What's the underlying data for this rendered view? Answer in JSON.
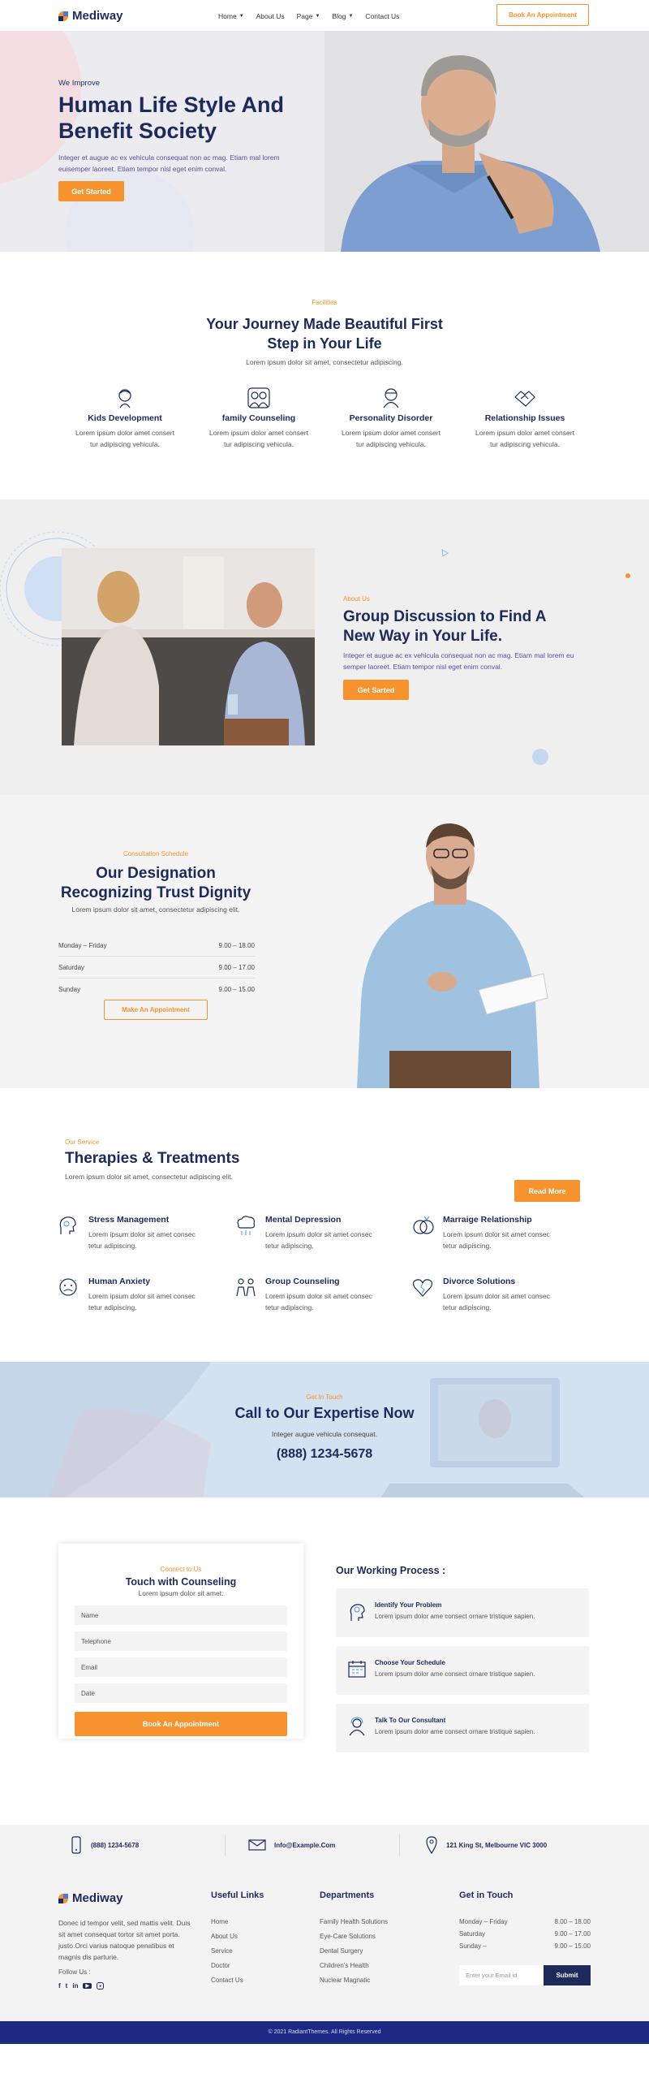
{
  "header": {
    "logo_text": "Mediway",
    "nav": [
      {
        "label": "Home",
        "dropdown": true
      },
      {
        "label": "About Us",
        "dropdown": false
      },
      {
        "label": "Page",
        "dropdown": true
      },
      {
        "label": "Blog",
        "dropdown": true
      },
      {
        "label": "Contact Us",
        "dropdown": false
      }
    ],
    "cta": "Book An Appointment"
  },
  "hero": {
    "kicker": "We Improve",
    "title_line1": "Human Life Style And",
    "title_line2": "Benefit Society",
    "text": "Integer et augue ac ex vehicula consequat non ac mag. Etiam mal lorem euisemper laoreet. Etiam tempor nisl eget enim conval.",
    "button": "Get Started"
  },
  "facilities": {
    "kicker": "Facilities",
    "title_line1": "Your Journey Made Beautiful First",
    "title_line2": "Step in Your Life",
    "subtitle": "Lorem ipsum dolor sit amet, consectetur adipiscing.",
    "items": [
      {
        "icon": "child-icon",
        "title": "Kids Development",
        "text1": "Lorem ipsum dolor amet consert",
        "text2": "tur adipiscing vehicula."
      },
      {
        "icon": "family-icon",
        "title": "family Counseling",
        "text1": "Lorem ipsum dolor amet consert",
        "text2": "tur adipiscing vehicula."
      },
      {
        "icon": "person-icon",
        "title": "Personality Disorder",
        "text1": "Lorem ipsum dolor amet consert",
        "text2": "tur adipiscing vehicula."
      },
      {
        "icon": "handshake-icon",
        "title": "Relationship Issues",
        "text1": "Lorem ipsum dolor amet consert",
        "text2": "tur adipiscing vehicula."
      }
    ]
  },
  "about": {
    "kicker": "About Us",
    "title_line1": "Group Discussion to Find A",
    "title_line2": "New Way in Your Life.",
    "text": "Integer et augue ac ex vehicula consequat non ac mag. Etiam mal lorem eu semper laoreet. Etiam tempor nisl eget enim conval.",
    "button": "Get Sarted"
  },
  "schedule": {
    "kicker": "Consultation Schedule",
    "title_line1": "Our Designation",
    "title_line2": "Recognizing Trust Dignity",
    "subtitle": "Lorem ipsum dolor sit amet, consectetur adipiscing elit.",
    "rows": [
      {
        "day": "Monday – Friday",
        "time": "9.00 – 18.00"
      },
      {
        "day": "Saturday",
        "time": "9.00 – 17.00"
      },
      {
        "day": "Sunday",
        "time": "9.00 – 15.00"
      }
    ],
    "button": "Make An Appointment"
  },
  "services": {
    "kicker": "Our Service",
    "title": "Therapies & Treatments",
    "subtitle": "Lorem ipsum dolor sit amet, consectetur adipiscing elit.",
    "button": "Read More",
    "items": [
      {
        "icon": "head-icon",
        "title": "Stress Management",
        "text1": "Lorem ipsum dolor sit amet consec",
        "text2": "tetur adipiscing."
      },
      {
        "icon": "brain-cloud-icon",
        "title": "Mental Depression",
        "text1": "Lorem ipsum dolor sit amet consec",
        "text2": "tetur adipiscing."
      },
      {
        "icon": "rings-icon",
        "title": "Marraige Relationship",
        "text1": "Lorem ipsum dolor sit amet consec",
        "text2": "tetur adipiscing."
      },
      {
        "icon": "anxiety-face-icon",
        "title": "Human Anxiety",
        "text1": "Lorem ipsum dolor sit amet consec",
        "text2": "tetur adipiscing."
      },
      {
        "icon": "group-icon",
        "title": "Group Counseling",
        "text1": "Lorem ipsum dolor sit amet consec",
        "text2": "tetur adipiscing."
      },
      {
        "icon": "broken-heart-icon",
        "title": "Divorce Solutions",
        "text1": "Lorem ipsum dolor sit amet consec",
        "text2": "tetur adipiscing."
      }
    ]
  },
  "call": {
    "kicker": "Get In Touch",
    "title": "Call to Our Expertise Now",
    "subtitle": "Integer augue vehicula consequat.",
    "phone": "(888) 1234-5678"
  },
  "contact_form": {
    "kicker": "Connect to Us",
    "title": "Touch with Counseling",
    "subtitle": "Lorem ipsum dolor sit amet.",
    "placeholders": [
      "Name",
      "Telephone",
      "Email",
      "Date"
    ],
    "button": "Book An Appointment"
  },
  "process": {
    "title": "Our Working Process :",
    "steps": [
      {
        "icon": "lightbulb-head-icon",
        "title": "Identify Your Problem",
        "text": "Lorem ipsum dolor ame consect ornare tristique sapien."
      },
      {
        "icon": "calendar-icon",
        "title": "Choose Your Schedule",
        "text": "Lorem ipsum dolor ame consect ornare tristique sapien."
      },
      {
        "icon": "consultant-icon",
        "title": "Talk To Our Consultant",
        "text": "Lorem ipsum dolor ame consect ornare tristique sapien."
      }
    ]
  },
  "contact_bar": {
    "phone": "(888) 1234-5678",
    "email": "Info@Example.Com",
    "address": "121 King St, Melbourne VIC 3000"
  },
  "footer": {
    "logo_text": "Mediway",
    "about": "Donec id tempor velit, sed mattis velit. Duis sit amet consequat tortor sit amet porta. justo.Orci varius natoque penatibus et magnis dis parturie.",
    "follow": "Follow Us :",
    "social": [
      "facebook-icon",
      "twitter-icon",
      "linkedin-icon",
      "youtube-icon",
      "instagram-icon"
    ],
    "useful_title": "Useful Links",
    "useful": [
      "Home",
      "About Us",
      "Service",
      "Doctor",
      "Contact Us"
    ],
    "dept_title": "Departments",
    "departments": [
      "Family Health Solutions",
      "Eye-Care Solutions",
      "Dental Surgery",
      "Children's Health",
      "Nuclear Magnatic"
    ],
    "touch_title": "Get in Touch",
    "hours": [
      {
        "day": "Monday – Friday",
        "time": "8.00 – 18.00"
      },
      {
        "day": "Saturday",
        "time": "9.00 – 17.00"
      },
      {
        "day": "Sunday –",
        "time": "9.00 – 15.00"
      }
    ],
    "email_placeholder": "Enter your Email id",
    "submit": "Submit",
    "copyright": "© 2021 RadiantThemes. All Rights Reserved"
  },
  "colors": {
    "navy": "#1c2a5c",
    "orange": "#f7932c",
    "light_bg": "#efefef",
    "footer_bar": "#1d2a83"
  }
}
